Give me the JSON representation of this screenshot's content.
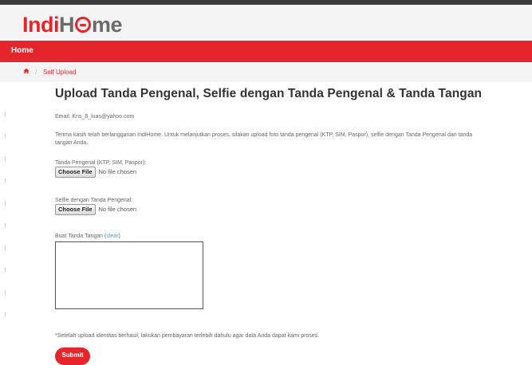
{
  "header": {
    "logo_part1": "Indi",
    "logo_part2": "H",
    "logo_part3": "me",
    "brand_color": "#e4262c"
  },
  "nav": {
    "home_label": "Home"
  },
  "breadcrumb": {
    "home_icon": "home-icon",
    "separator": "/",
    "current": "Self Upload"
  },
  "page": {
    "title": "Upload Tanda Pengenal, Selfie dengan Tanda Pengenal & Tanda Tangan",
    "email_line": "Email: Kris_8_luas@yahoo.com",
    "intro": "Terima kasih telah berlangganan IndiHome. Untuk melanjutkan proses, silakan upload foto tanda pengenal (KTP, SIM, Paspor), selfie dengan Tanda Pengenal dan tanda tangan Anda."
  },
  "form": {
    "id_label": "Tanda Pengenal (KTP, SIM, Paspor):",
    "selfie_label": "Selfie dengan Tanda Pengenal:",
    "choose_file_label": "Choose File",
    "no_file_text": "No file chosen",
    "signature_label": "Buat Tanda Tangan (",
    "signature_clear": "clear",
    "signature_close": ")",
    "note": "*Setelah upload identitas berhasil, lakukan pembayaran terlebih dahulu agar data Anda dapat kami proses.",
    "submit_label": "Submit"
  }
}
